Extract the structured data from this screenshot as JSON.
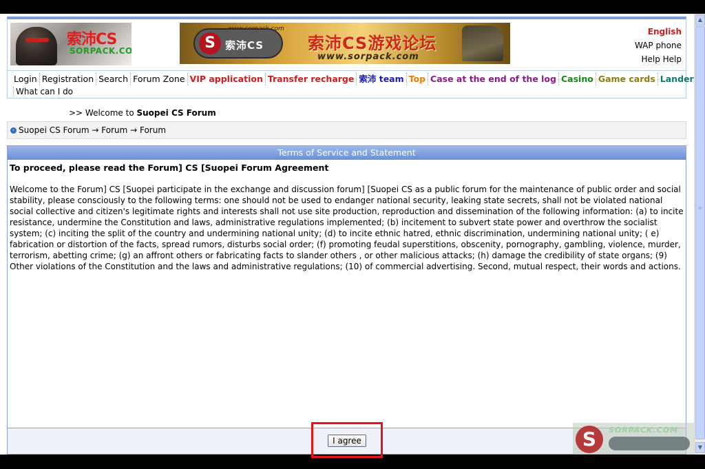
{
  "header": {
    "logo_brand_text": "索沛CS",
    "logo_sub_text": "SORPACK.COM",
    "banner": {
      "url_top": "www.sorpack.com",
      "disc_text": "索沛CS",
      "title_cn": "索沛CS游戏论坛",
      "url_bottom": "www.sorpack.com"
    },
    "links": {
      "english": "English",
      "wap": "WAP phone",
      "help": "Help Help"
    }
  },
  "nav": {
    "items": [
      {
        "label": "Login",
        "color": "#000000"
      },
      {
        "label": "Registration",
        "color": "#000000"
      },
      {
        "label": "Search",
        "color": "#000000"
      },
      {
        "label": "Forum Zone",
        "color": "#000000"
      },
      {
        "label": "VIP application",
        "color": "#d01c1c"
      },
      {
        "label": "Transfer recharge",
        "color": "#d01c1c"
      },
      {
        "label": "索沛 team",
        "color": "#1b1bb5"
      },
      {
        "label": "Top",
        "color": "#f07a00"
      },
      {
        "label": "Case at the end of the log",
        "color": "#8b1a8b"
      },
      {
        "label": "Casino",
        "color": "#138a13"
      },
      {
        "label": "Game cards",
        "color": "#8a7d12"
      },
      {
        "label": "Landers",
        "color": "#0f7a6f"
      }
    ],
    "second_row": "What can I do"
  },
  "welcome": {
    "prefix": ">> Welcome to ",
    "forum_name": "Suopei CS Forum"
  },
  "breadcrumb": "Suopei CS Forum → Forum → Forum",
  "terms": {
    "header": "Terms of Service and Statement",
    "title": "To proceed, please read the Forum] CS [Suopei Forum Agreement",
    "body": "Welcome to the Forum] CS [Suopei participate in the exchange and discussion forum] [Suopei CS as a public forum for the maintenance of public order and social stability, please consciously to the following terms: one should not be used to endanger national security, leaking state secrets, shall not be violated national social collective and citizen's legitimate rights and interests shall not use site production, reproduction and dissemination of the following information: (a) to incite resistance, undermine the Constitution and laws, administrative regulations implemented; (b) incitement to subvert state power and overthrow the socialist system; (c) inciting the split of the country and undermining national unity; (d) to incite ethnic hatred, ethnic discrimination, undermining national unity; ( e) fabrication or distortion of the facts, spread rumors, disturbs social order; (f) promoting feudal superstitions, obscenity, pornography, gambling, violence, murder, terrorism, abetting crime; (g) an affront others or fabricating facts to slander others , or other malicious attacks; (h) damage the credibility of state organs; (9) Other violations of the Constitution and the laws and administrative regulations; (10) of commercial advertising. Second, mutual respect, their words and actions.",
    "agree_label": "I agree"
  },
  "watermark": {
    "url": "SORPACK.COM",
    "letter": "S"
  },
  "colors": {
    "accent_blue": "#7a9bd6",
    "highlight_red": "#e8121b"
  }
}
